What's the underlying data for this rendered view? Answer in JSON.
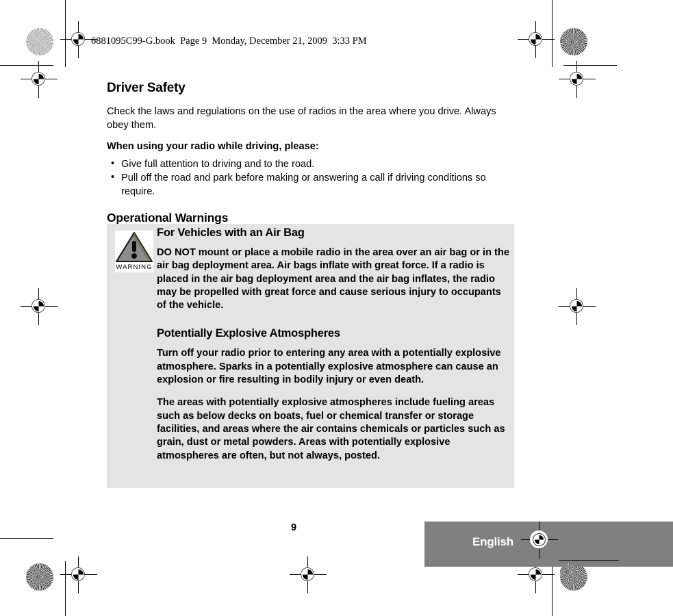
{
  "document": {
    "header_line": "6881095C99-G.book  Page 9  Monday, December 21, 2009  3:33 PM",
    "page_number": "9",
    "language_banner": "English",
    "colors": {
      "warning_box_background": "#e4e4e4",
      "language_banner_background": "#808080",
      "language_banner_text": "#ffffff",
      "text": "#000000",
      "warning_triangle_fill": "#8c8c8c"
    }
  },
  "content": {
    "section_title": "Driver Safety",
    "intro_paragraph": "Check the laws and regulations on the use of radios in the area where you drive. Always obey them.",
    "lead_in": "When using your radio while driving, please:",
    "bullets": [
      "Give full attention to driving and to the road.",
      "Pull off the road and park before making or answering a call if driving conditions so require."
    ],
    "bullet_glyph": "•",
    "operational_title": "Operational Warnings"
  },
  "warning": {
    "icon_name": "warning-triangle-icon",
    "icon_label": "WARNING",
    "blocks": [
      {
        "heading": "For Vehicles with an Air Bag",
        "paragraphs": [
          "DO NOT mount or place a mobile radio in the area over an air bag or in the air bag deployment area. Air bags inflate with great force. If a radio is placed in the air bag deployment area and the air bag inflates, the radio may be propelled with great force and cause serious injury to occupants of the vehicle."
        ]
      },
      {
        "heading": "Potentially Explosive Atmospheres",
        "paragraphs": [
          "Turn off your radio prior to entering any area with a potentially explosive atmosphere. Sparks in a potentially explosive atmosphere can cause an explosion or fire resulting in bodily injury or even death.",
          "The areas with potentially explosive atmospheres include fueling areas such as below decks on boats, fuel or chemical transfer or storage facilities, and areas where the air contains chemicals or particles such as grain, dust or metal powders. Areas with potentially explosive atmospheres are often, but not always, posted."
        ]
      }
    ]
  }
}
